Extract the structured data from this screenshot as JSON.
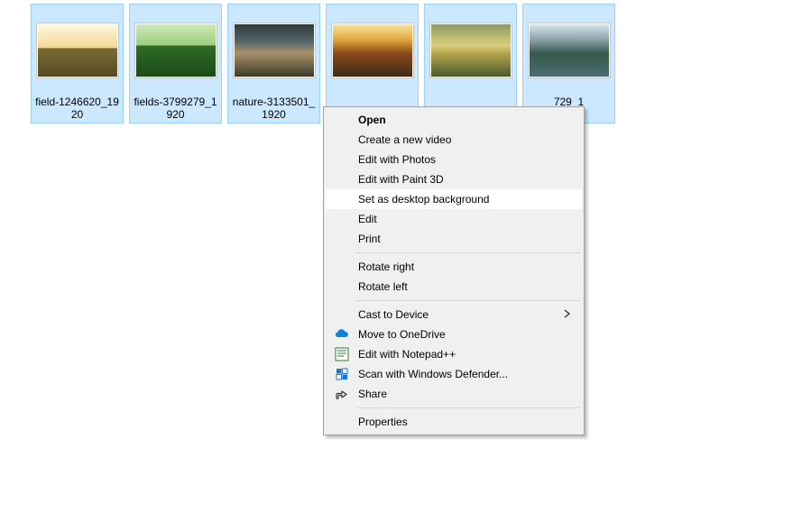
{
  "files": [
    {
      "name": "field-1246620_1920",
      "gradient": "linear-gradient(to bottom,#fef8df 0%,#f3d891 45%,#7b6b35 46%,#564a24 100%)"
    },
    {
      "name": "fields-3799279_1920",
      "gradient": "linear-gradient(to bottom,#cfe8b7 0%,#9cce81 40%,#2f6b26 41%,#1e4a18 100%)"
    },
    {
      "name": "nature-3133501_1920",
      "gradient": "linear-gradient(to bottom,#2e3a3d 0%,#5a686b 35%,#a8906a 55%,#3a3b28 100%)"
    },
    {
      "name": "",
      "gradient": "linear-gradient(to bottom,#f7e6a0 0%,#e0a53a 30%,#8b4b1d 55%,#3d2b14 100%)"
    },
    {
      "name": "",
      "gradient": "linear-gradient(to bottom,#8d9a5f 0%,#d9cf7e 40%,#b6a64e 55%,#4a5a2d 100%)"
    },
    {
      "name": "729_1",
      "gradient": "linear-gradient(to bottom,#d6e7ec 0%,#8aa0a8 30%,#37594a 55%,#4b6d73 100%)"
    }
  ],
  "menu": [
    {
      "type": "item",
      "label": "Open",
      "bold": true
    },
    {
      "type": "item",
      "label": "Create a new video"
    },
    {
      "type": "item",
      "label": "Edit with Photos"
    },
    {
      "type": "item",
      "label": "Edit with Paint 3D"
    },
    {
      "type": "item",
      "label": "Set as desktop background",
      "hover": true
    },
    {
      "type": "item",
      "label": "Edit"
    },
    {
      "type": "item",
      "label": "Print"
    },
    {
      "type": "sep"
    },
    {
      "type": "item",
      "label": "Rotate right"
    },
    {
      "type": "item",
      "label": "Rotate left"
    },
    {
      "type": "sep"
    },
    {
      "type": "item",
      "label": "Cast to Device",
      "submenu": true
    },
    {
      "type": "item",
      "label": "Move to OneDrive",
      "icon": "onedrive"
    },
    {
      "type": "item",
      "label": "Edit with Notepad++",
      "icon": "notepadpp"
    },
    {
      "type": "item",
      "label": "Scan with Windows Defender...",
      "icon": "defender"
    },
    {
      "type": "item",
      "label": "Share",
      "icon": "share"
    },
    {
      "type": "sep"
    },
    {
      "type": "item",
      "label": "Properties"
    }
  ],
  "colors": {
    "selection_bg": "#cce8ff",
    "selection_border": "#99d1ff",
    "menu_bg": "#f0f0f0",
    "menu_border": "#a0a0a0",
    "menu_hover": "#ffffff"
  }
}
